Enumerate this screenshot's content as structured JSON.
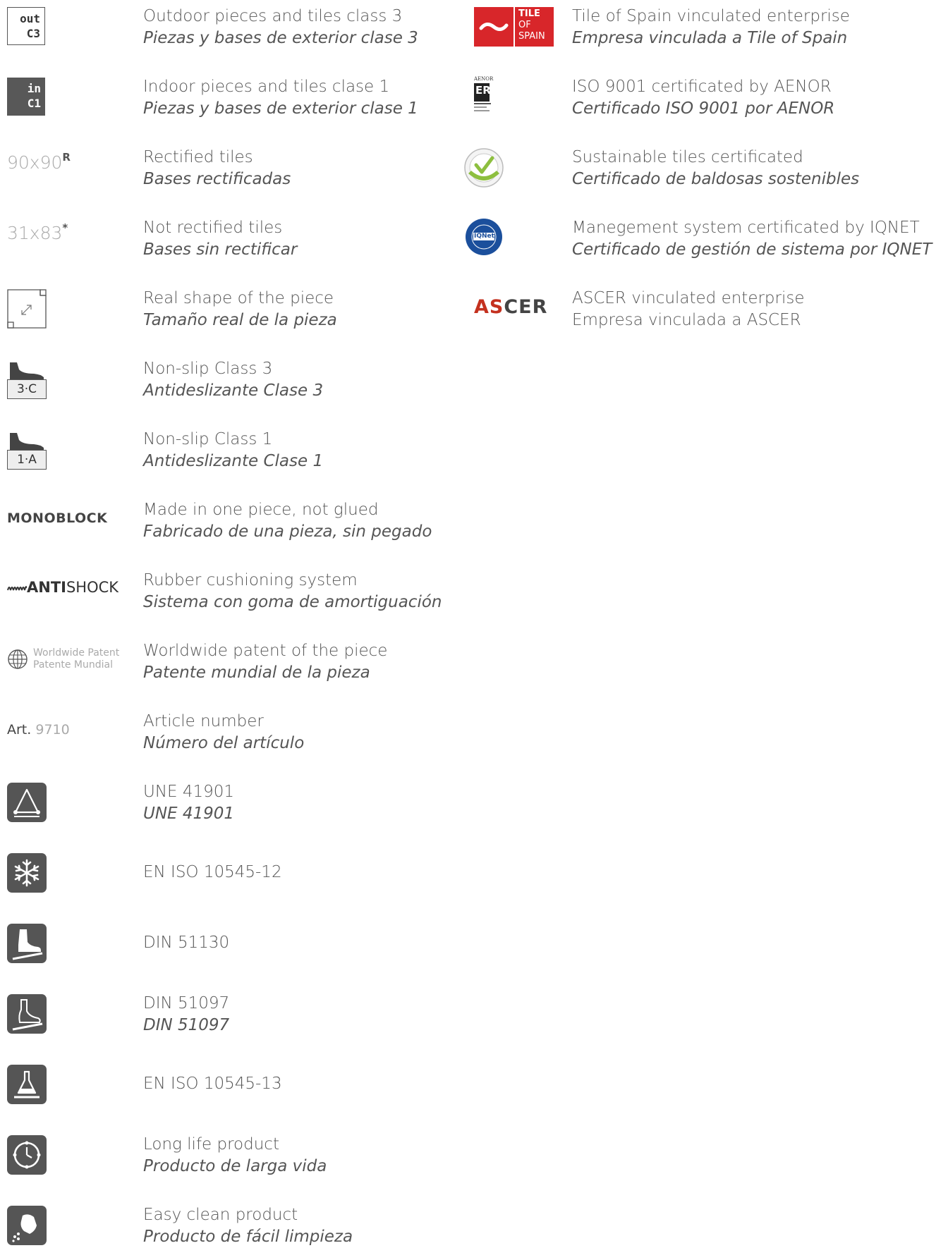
{
  "left_items": [
    {
      "icon": "outdoor-c3-badge",
      "badge_line1": "out",
      "badge_line2": "C3",
      "en": "Outdoor pieces and tiles class 3",
      "es": "Piezas y bases de exterior clase 3"
    },
    {
      "icon": "indoor-c1-badge",
      "badge_line1": "in",
      "badge_line2": "C1",
      "en": "Indoor pieces and tiles clase 1",
      "es": "Piezas y bases de exterior clase 1"
    },
    {
      "icon": "rectified-size-label",
      "size": "90x90",
      "mark": "R",
      "en": "Rectified tiles",
      "es": "Bases rectificadas"
    },
    {
      "icon": "not-rectified-size-label",
      "size": "31x83",
      "mark": "*",
      "en": "Not rectified tiles",
      "es": "Bases sin rectificar"
    },
    {
      "icon": "real-shape-icon",
      "en": "Real shape of the piece",
      "es": "Tamaño real de la pieza"
    },
    {
      "icon": "non-slip-3c-icon",
      "badge_label": "3·C",
      "en": "Non-slip Class 3",
      "es": "Antideslizante Clase 3"
    },
    {
      "icon": "non-slip-1a-icon",
      "badge_label": "1·A",
      "en": "Non-slip Class 1",
      "es": "Antideslizante Clase 1"
    },
    {
      "icon": "monoblock-label",
      "label": "MONOBLOCK",
      "en": "Made in one piece, not glued",
      "es": "Fabricado de una pieza, sin pegado"
    },
    {
      "icon": "antishock-label",
      "label_bold": "ANTI",
      "label_rest": "SHOCK",
      "en": "Rubber cushioning system",
      "es": "Sistema con goma de amortiguación"
    },
    {
      "icon": "worldwide-patent-icon",
      "label1": "Worldwide Patent",
      "label2": "Patente Mundial",
      "en": "Worldwide patent of the piece",
      "es": "Patente mundial de la pieza"
    },
    {
      "icon": "article-number-label",
      "label": "Art.",
      "number": "9710",
      "en": "Article number",
      "es": "Número del artículo"
    },
    {
      "icon": "une-41901-icon",
      "en": "UNE 41901",
      "es": "UNE 41901"
    },
    {
      "icon": "snowflake-icon",
      "en": "EN ISO 10545-12",
      "es": ""
    },
    {
      "icon": "shoe-slope-icon",
      "en": "DIN 51130",
      "es": ""
    },
    {
      "icon": "barefoot-slope-icon",
      "en": "DIN 51097",
      "es": "DIN 51097"
    },
    {
      "icon": "chemical-flask-icon",
      "en": "EN ISO 10545-13",
      "es": ""
    },
    {
      "icon": "clock-icon",
      "en": "Long life product",
      "es": "Producto de larga vida"
    },
    {
      "icon": "cleaning-spray-icon",
      "en": "Easy clean product",
      "es": "Producto de fácil limpieza"
    }
  ],
  "right_items": [
    {
      "icon": "tile-of-spain-logo",
      "logo_line1": "TILE",
      "logo_line2": "OF",
      "logo_line3": "SPAIN",
      "en": "Tile of Spain vinculated enterprise",
      "es": "Empresa vinculada a Tile of Spain"
    },
    {
      "icon": "aenor-er-logo",
      "logo_top": "AENOR",
      "logo_mark": "ER",
      "en": "ISO 9001 certificated by AENOR",
      "es": "Certificado ISO 9001 por AENOR"
    },
    {
      "icon": "sustainable-tiles-seal",
      "en": "Sustainable tiles certificated",
      "es": "Certificado de baldosas sostenibles"
    },
    {
      "icon": "iqnet-seal",
      "logo_mark": "IQNet",
      "en": "Manegement system certificated by IQNET",
      "es": "Certificado de gestión de sistema por IQNET"
    },
    {
      "icon": "ascer-logo",
      "logo_start": "A",
      "logo_red": "S",
      "logo_end": "CER",
      "en": "ASCER vinculated enterprise",
      "es": "Empresa vinculada a ASCER"
    }
  ],
  "colors": {
    "text": "#555555",
    "dark_tile": "#555555",
    "tile_of_spain_red": "#d8262a",
    "ascer_red": "#c4311f",
    "seal_green": "#8dbf3f",
    "iqnet_blue": "#1b4f9c"
  }
}
